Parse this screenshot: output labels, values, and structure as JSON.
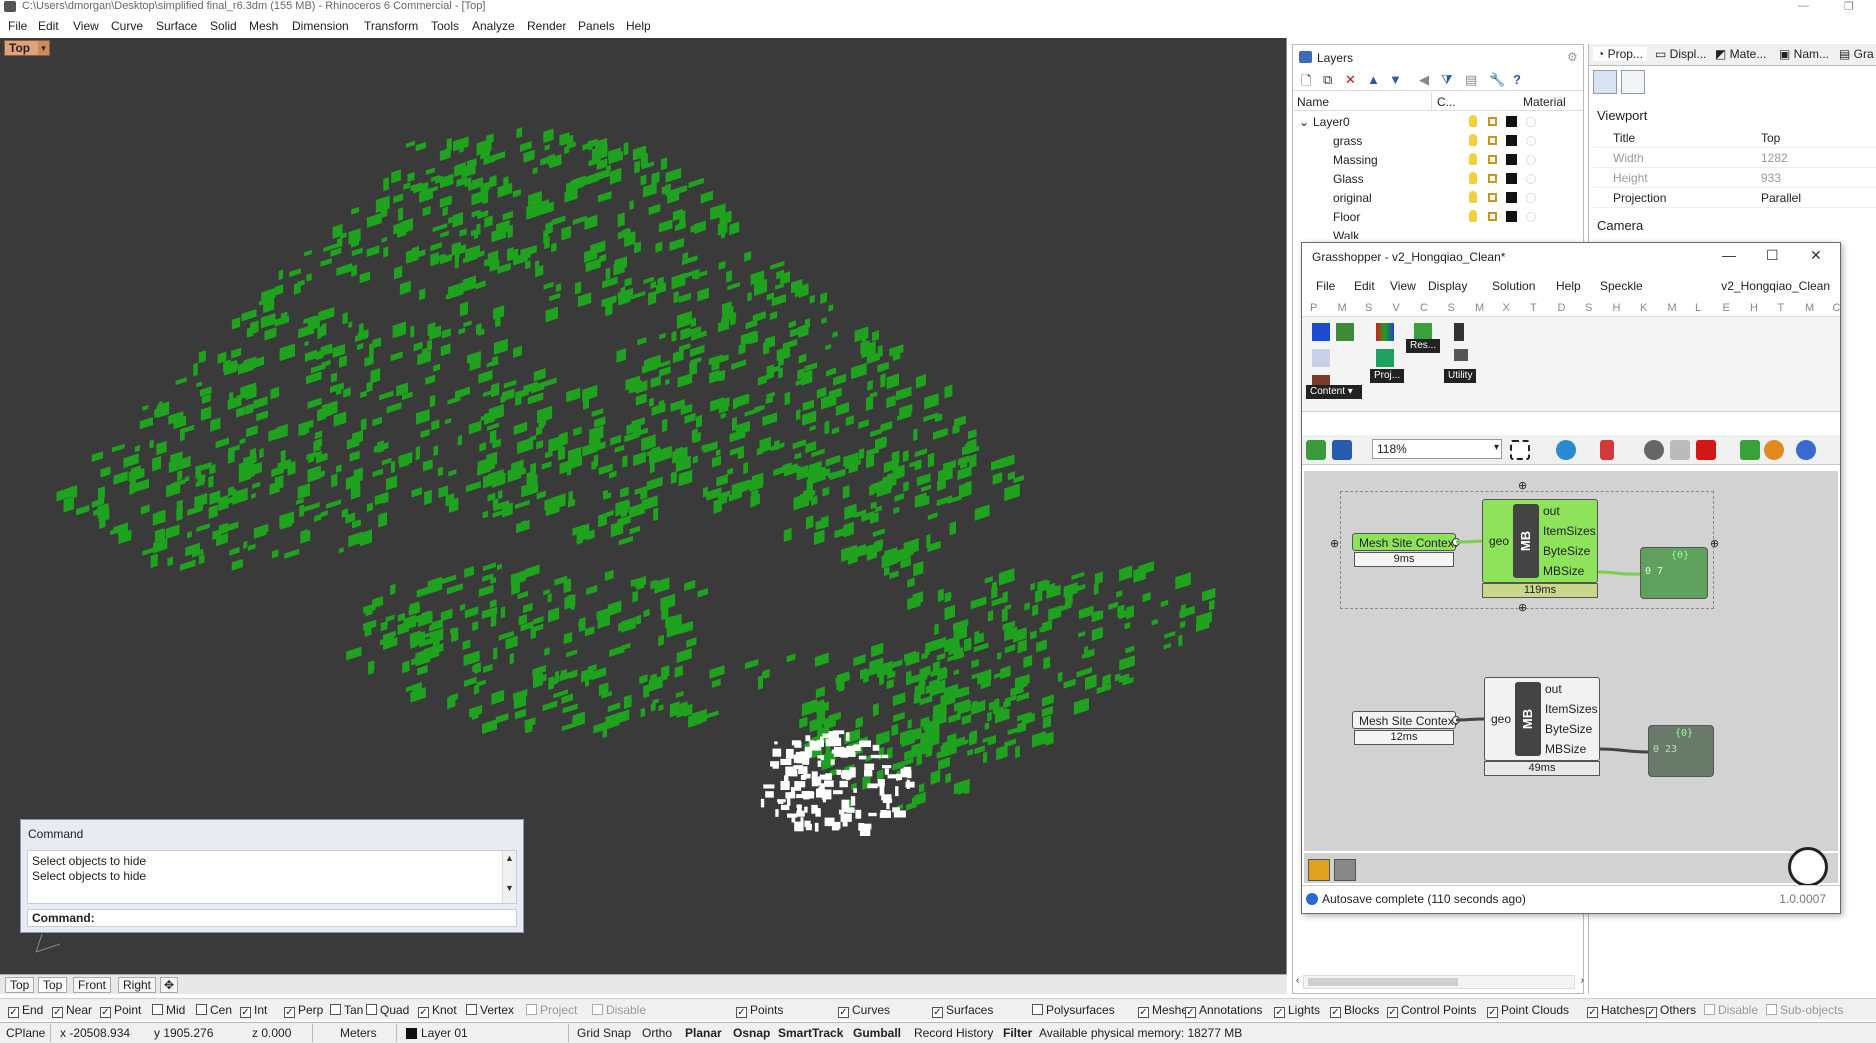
{
  "window": {
    "title": "C:\\Users\\dmorgan\\Desktop\\simplified final_r6.3dm (155 MB) - Rhinoceros 6 Commercial - [Top]"
  },
  "menu": [
    "File",
    "Edit",
    "View",
    "Curve",
    "Surface",
    "Solid",
    "Mesh",
    "Dimension",
    "Transform",
    "Tools",
    "Analyze",
    "Render",
    "Panels",
    "Help"
  ],
  "viewport": {
    "name": "Top",
    "tabs": [
      "Top",
      "Top",
      "Front",
      "Right"
    ],
    "colors": {
      "background": "#3a3a3a",
      "massing": "#1fa31f",
      "selected": "#ffffff"
    }
  },
  "command": {
    "title": "Command",
    "history": [
      "Select objects to hide",
      "Select objects to hide"
    ],
    "prompt": "Command:"
  },
  "osnaps": [
    {
      "label": "End",
      "checked": true
    },
    {
      "label": "Near",
      "checked": true
    },
    {
      "label": "Point",
      "checked": true
    },
    {
      "label": "Mid",
      "checked": false
    },
    {
      "label": "Cen",
      "checked": false
    },
    {
      "label": "Int",
      "checked": true
    },
    {
      "label": "Perp",
      "checked": true
    },
    {
      "label": "Tan",
      "checked": false
    },
    {
      "label": "Quad",
      "checked": false
    },
    {
      "label": "Knot",
      "checked": true
    },
    {
      "label": "Vertex",
      "checked": false
    },
    {
      "label": "Project",
      "checked": false
    },
    {
      "label": "Disable",
      "checked": false
    }
  ],
  "filters": [
    {
      "label": "Points",
      "checked": true
    },
    {
      "label": "Curves",
      "checked": true
    },
    {
      "label": "Surfaces",
      "checked": true
    },
    {
      "label": "Polysurfaces",
      "checked": false
    },
    {
      "label": "Meshes",
      "checked": true
    },
    {
      "label": "Annotations",
      "checked": true
    },
    {
      "label": "Lights",
      "checked": true
    },
    {
      "label": "Blocks",
      "checked": true
    },
    {
      "label": "Control Points",
      "checked": true
    },
    {
      "label": "Point Clouds",
      "checked": true
    },
    {
      "label": "Hatches",
      "checked": true
    },
    {
      "label": "Others",
      "checked": true
    },
    {
      "label": "Disable",
      "checked": false
    },
    {
      "label": "Sub-objects",
      "checked": false
    }
  ],
  "status": {
    "cplane": "CPlane",
    "x": "x -20508.934",
    "y": "y 1905.276",
    "z": "z 0.000",
    "units": "Meters",
    "layer": "Layer 01",
    "grid_snap": "Grid Snap",
    "ortho": "Ortho",
    "planar": "Planar",
    "osnap": "Osnap",
    "smarttrack": "SmartTrack",
    "gumball": "Gumball",
    "record_history": "Record History",
    "filter": "Filter",
    "memory": "Available physical memory: 18277 MB"
  },
  "layers": {
    "tab": "Layers",
    "columns": {
      "name": "Name",
      "color": "C...",
      "material": "Material"
    },
    "root": "Layer0",
    "items": [
      "grass",
      "Massing",
      "Glass",
      "original",
      "Floor",
      "Walk"
    ]
  },
  "properties": {
    "tabs": [
      "Prop...",
      "Displ...",
      "Mate...",
      "Nam...",
      "Gra"
    ],
    "section_viewport": "Viewport",
    "rows": [
      {
        "k": "Title",
        "v": "Top",
        "ro": false
      },
      {
        "k": "Width",
        "v": "1282",
        "ro": true
      },
      {
        "k": "Height",
        "v": "933",
        "ro": true
      },
      {
        "k": "Projection",
        "v": "Parallel",
        "ro": false
      }
    ],
    "section_camera": "Camera"
  },
  "grasshopper": {
    "title": "Grasshopper - v2_Hongqiao_Clean*",
    "menu": [
      "File",
      "Edit",
      "View",
      "Display",
      "Solution",
      "Help",
      "Speckle"
    ],
    "doc": "v2_Hongqiao_Clean",
    "categories": [
      "P",
      "M",
      "S",
      "V",
      "C",
      "S",
      "M",
      "X",
      "T",
      "D",
      "S",
      "H",
      "K",
      "M",
      "L",
      "E",
      "H",
      "T",
      "M",
      "C"
    ],
    "ribbon_groups": [
      "Content",
      "Proj...",
      "Res...",
      "Utility"
    ],
    "zoom": "118%",
    "components": [
      {
        "source": "Mesh Site Context",
        "source_time": "9ms",
        "input": "geo",
        "nickname": "MB",
        "outputs": [
          "out",
          "ItemSizes",
          "ByteSize",
          "MBSize"
        ],
        "time": "119ms",
        "panel_header": "{0}",
        "panel_value": "0 7",
        "enabled": true
      },
      {
        "source": "Mesh Site Context",
        "source_time": "12ms",
        "input": "geo",
        "nickname": "MB",
        "outputs": [
          "out",
          "ItemSizes",
          "ByteSize",
          "MBSize"
        ],
        "time": "49ms",
        "panel_header": "{0}",
        "panel_value": "0 23",
        "enabled": false
      }
    ],
    "status": "Autosave complete (110 seconds ago)",
    "version": "1.0.0007"
  }
}
